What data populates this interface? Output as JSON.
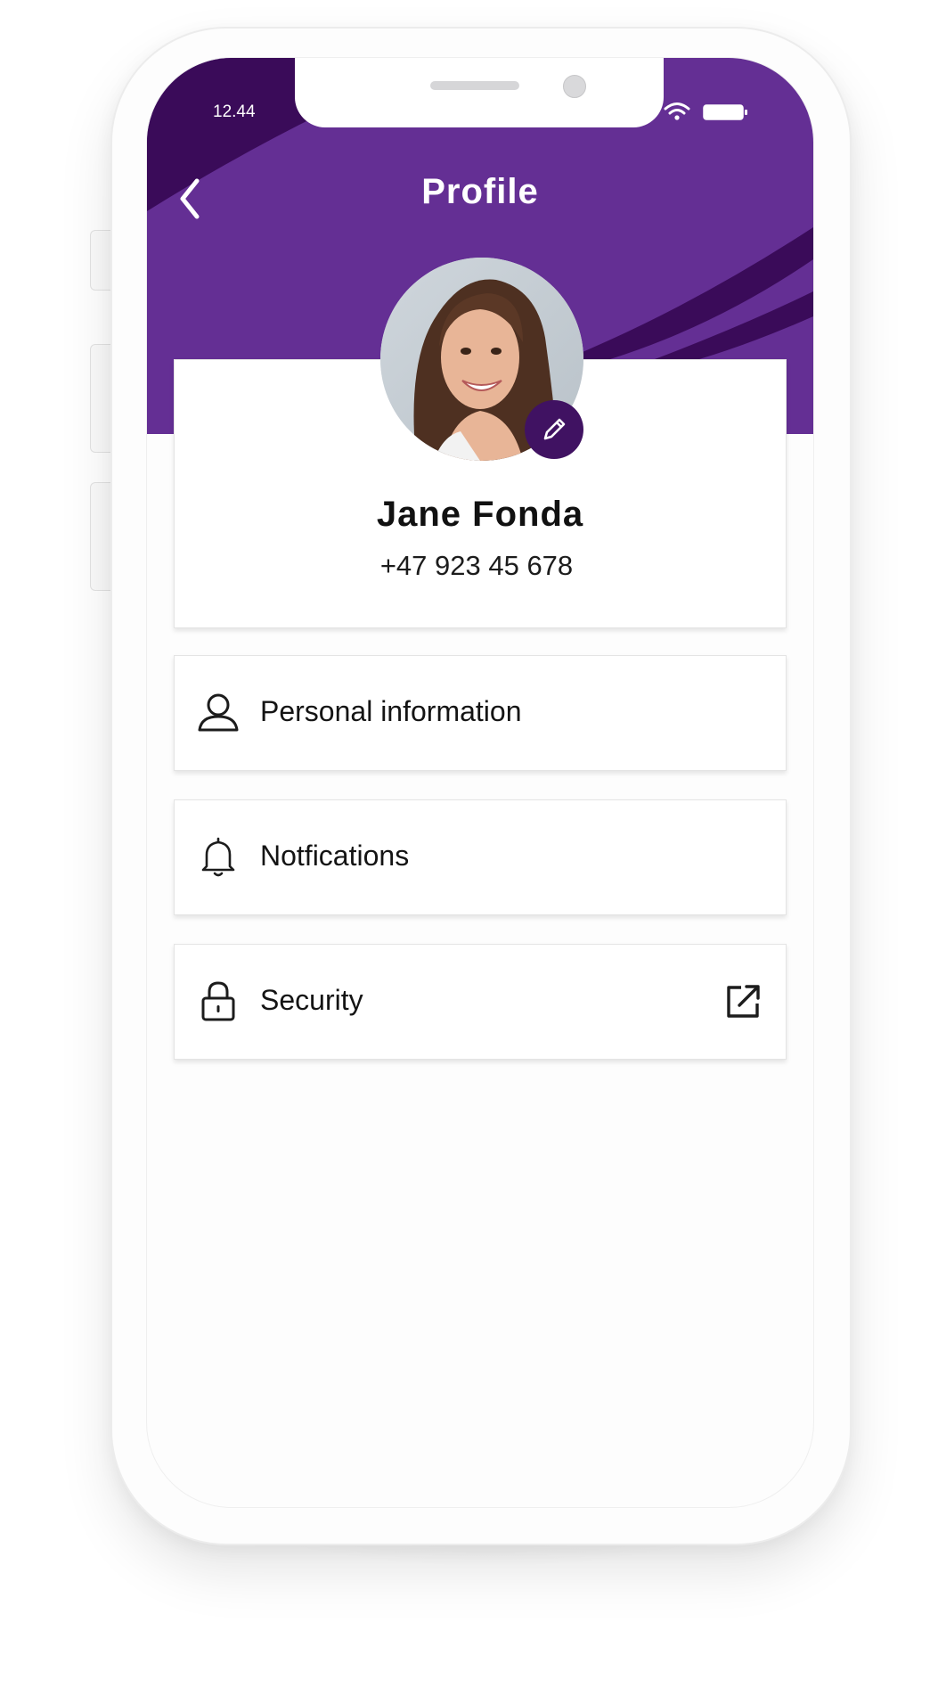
{
  "status_bar": {
    "time": "12.44",
    "icons": [
      "wifi-icon",
      "battery-icon"
    ]
  },
  "header": {
    "title": "Profile",
    "back_icon": "chevron-left-icon"
  },
  "profile": {
    "name": "Jane Fonda",
    "phone": "+47 923 45 678",
    "edit_icon": "pencil-icon"
  },
  "menu": {
    "items": [
      {
        "label": "Personal information",
        "icon": "user-icon"
      },
      {
        "label": "Notfications",
        "icon": "bell-icon"
      },
      {
        "label": "Security",
        "icon": "lock-icon",
        "trailing_icon": "external-link-icon"
      }
    ]
  },
  "colors": {
    "header_purple": "#642f94",
    "dark_purple": "#3a0b59",
    "badge_purple": "#401262",
    "text": "#141414",
    "card_bg": "#ffffff"
  }
}
